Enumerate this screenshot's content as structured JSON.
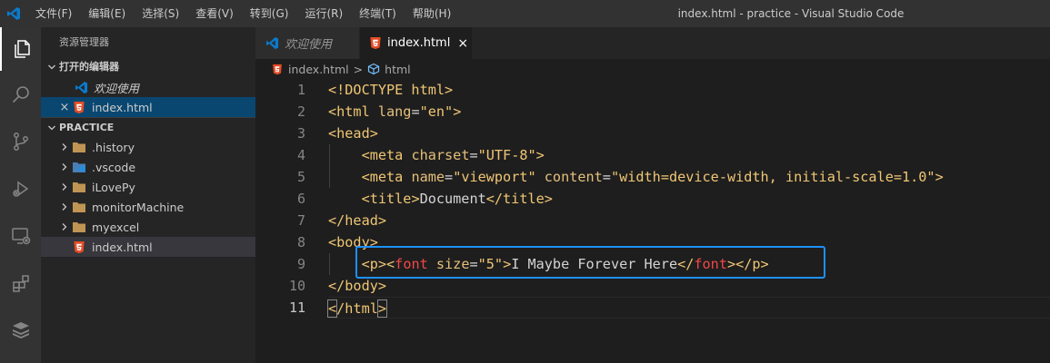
{
  "app": {
    "window_title": "index.html - practice - Visual Studio Code",
    "menu": [
      "文件(F)",
      "编辑(E)",
      "选择(S)",
      "查看(V)",
      "转到(G)",
      "运行(R)",
      "终端(T)",
      "帮助(H)"
    ]
  },
  "colors": {
    "accent_vscode": "#0078d4",
    "html_icon": "#e44d26",
    "folder": "#c09553",
    "highlight_box": "#1e90ff"
  },
  "sidebar": {
    "title": "资源管理器",
    "open_editors": {
      "header": "打开的编辑器",
      "items": [
        {
          "label": "欢迎使用",
          "icon": "vscode-icon",
          "italic": true
        },
        {
          "label": "index.html",
          "icon": "html5-icon",
          "close": "×"
        }
      ]
    },
    "practice": {
      "header": "PRACTICE",
      "items": [
        {
          "label": ".history",
          "icon": "folder-icon"
        },
        {
          "label": ".vscode",
          "icon": "folder-vscode-icon"
        },
        {
          "label": "iLovePy",
          "icon": "folder-icon"
        },
        {
          "label": "monitorMachine",
          "icon": "folder-icon"
        },
        {
          "label": "myexcel",
          "icon": "folder-icon"
        },
        {
          "label": "index.html",
          "icon": "html5-icon"
        }
      ]
    }
  },
  "tabs": [
    {
      "label": "欢迎使用",
      "italic": true,
      "icon": "vscode-icon"
    },
    {
      "label": "index.html",
      "active": true,
      "icon": "html5-icon",
      "close": "×"
    }
  ],
  "breadcrumb": {
    "file": "index.html",
    "symbol": "html",
    "separator": ">"
  },
  "editor": {
    "line_numbers": [
      "1",
      "2",
      "3",
      "4",
      "5",
      "6",
      "7",
      "8",
      "9",
      "10",
      "11"
    ],
    "lines": {
      "l1": "<!DOCTYPE html>",
      "l2_open": "<html ",
      "l2_attr": "lang",
      "l2_eq": "=",
      "l2_val": "\"en\"",
      "l2_close": ">",
      "l3": "<head>",
      "l4_indent": "    ",
      "l4_open": "<meta ",
      "l4_attr": "charset",
      "l4_eq": "=",
      "l4_val": "\"UTF-8\"",
      "l4_close": ">",
      "l5_indent": "    ",
      "l5_open": "<meta ",
      "l5_attr1": "name",
      "l5_eq1": "=",
      "l5_val1": "\"viewport\"",
      "l5_sp": " ",
      "l5_attr2": "content",
      "l5_eq2": "=",
      "l5_val2": "\"width=device-width, initial-scale=1.0\"",
      "l5_close": ">",
      "l6_indent": "    ",
      "l6_open": "<title>",
      "l6_text": "Document",
      "l6_close": "</title>",
      "l7": "</head>",
      "l8": "<body>",
      "l9_indent": "    ",
      "l9_p_open": "<p>",
      "l9_font_lt": "<",
      "l9_font_name": "font",
      "l9_attr": " size",
      "l9_eq": "=",
      "l9_val": "\"5\"",
      "l9_gt": ">",
      "l9_text": "I Maybe Forever Here",
      "l9_font_close_lt": "</",
      "l9_font_close_name": "font",
      "l9_font_close_gt": ">",
      "l9_p_close": "</p>",
      "l10": "</body>",
      "l11_lt": "<",
      "l11_mid": "/html",
      "l11_gt": ">"
    }
  }
}
